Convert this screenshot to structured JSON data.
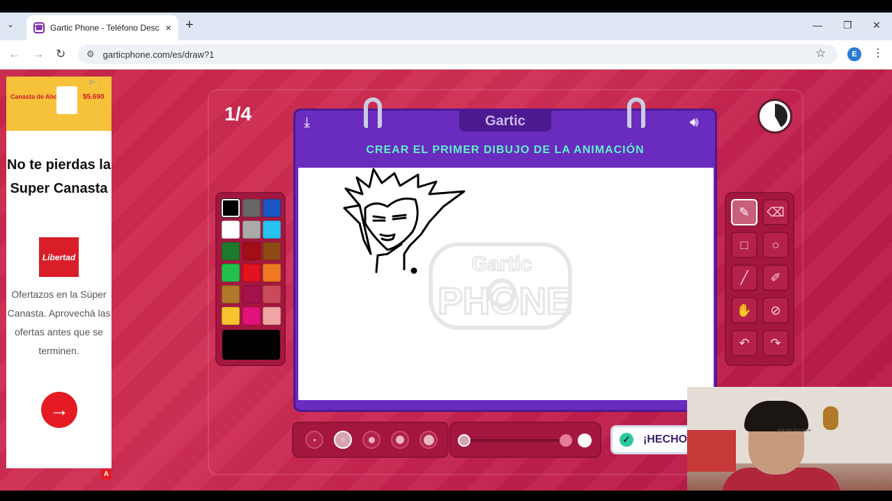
{
  "browser": {
    "tab_title": "Gartic Phone - Teléfono Descon",
    "url": "garticphone.com/es/draw?1",
    "profile_initial": "E"
  },
  "ad": {
    "banner_brand": "Canasta de Ahorro",
    "banner_price": "$5.690",
    "headline": "No te pierdas la Super Canasta",
    "logo_text": "Libertad",
    "body": "Ofertazos en la Súper Canasta. Aprovechá las ofertas antes que se terminen.",
    "badge": "A"
  },
  "game": {
    "round_counter": "1/4",
    "logo": "Gartic",
    "instruction": "CREAR EL PRIMER DIBUJO DE LA ANIMACIÓN",
    "watermark_top": "Gartic",
    "watermark_bottom": "PHONE",
    "done_label": "¡HECHO",
    "timer_elapsed_fraction": 0.42,
    "colors": [
      "#000000",
      "#666666",
      "#1a56c4",
      "#ffffff",
      "#aaaaaa",
      "#27c2ee",
      "#1d7a2a",
      "#a30d16",
      "#8a4a12",
      "#22c24a",
      "#e2121e",
      "#ef7a22",
      "#b07a2a",
      "#a3124a",
      "#c94b5a",
      "#f5c42e",
      "#e2127a",
      "#f0a5a5"
    ],
    "selected_color_index": 0,
    "current_color": "#000000",
    "tools": [
      {
        "name": "pencil-tool",
        "glyph": "✎",
        "selected": true
      },
      {
        "name": "eraser-tool",
        "glyph": "⌫",
        "selected": false
      },
      {
        "name": "rectangle-tool",
        "glyph": "□",
        "selected": false
      },
      {
        "name": "ellipse-tool",
        "glyph": "○",
        "selected": false
      },
      {
        "name": "line-tool",
        "glyph": "╱",
        "selected": false
      },
      {
        "name": "eyedropper-tool",
        "glyph": "✐",
        "selected": false
      },
      {
        "name": "fill-tool",
        "glyph": "✋",
        "selected": false
      },
      {
        "name": "clear-tool",
        "glyph": "⊘",
        "selected": false
      },
      {
        "name": "undo-tool",
        "glyph": "↶",
        "selected": false
      },
      {
        "name": "redo-tool",
        "glyph": "↷",
        "selected": false
      }
    ],
    "brush_sizes": 5,
    "selected_brush_size_index": 1,
    "opacity_level": 1.0
  },
  "webcam": {
    "overlay_text": "que me hizo pane"
  }
}
